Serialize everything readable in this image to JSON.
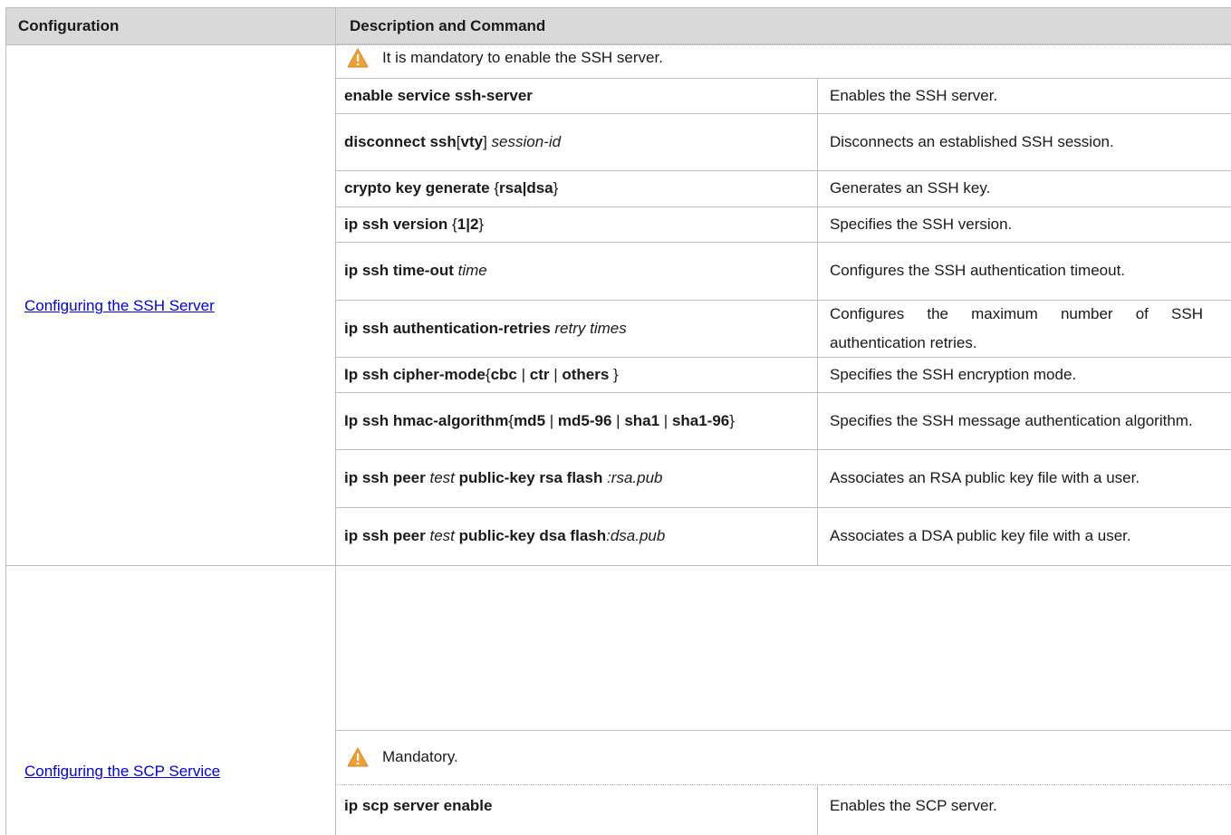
{
  "header": {
    "col1": "Configuration",
    "col2": "Description and Command"
  },
  "sections": [
    {
      "config_link": "Configuring the SSH Server",
      "note": "It is mandatory to enable the SSH server.",
      "note_icon": "warning-icon",
      "rows": [
        {
          "cmd_parts": [
            [
              "b",
              "enable service ssh-server"
            ]
          ],
          "desc": "Enables the SSH server."
        },
        {
          "cmd_parts": [
            [
              "b",
              "disconnect ssh"
            ],
            [
              "t",
              "["
            ],
            [
              "b",
              "vty"
            ],
            [
              "t",
              "] "
            ],
            [
              "i",
              "session-id"
            ]
          ],
          "desc": "Disconnects an established SSH session."
        },
        {
          "cmd_parts": [
            [
              "b",
              "crypto key generate "
            ],
            [
              "t",
              "{"
            ],
            [
              "b",
              "rsa|dsa"
            ],
            [
              "t",
              "}"
            ]
          ],
          "desc": "Generates an SSH key."
        },
        {
          "cmd_parts": [
            [
              "b",
              "ip ssh version "
            ],
            [
              "t",
              "{"
            ],
            [
              "b",
              "1|2"
            ],
            [
              "t",
              "}"
            ]
          ],
          "desc": "Specifies the SSH version."
        },
        {
          "cmd_parts": [
            [
              "b",
              "ip ssh time-out "
            ],
            [
              "i",
              "time"
            ]
          ],
          "desc": "Configures the SSH authentication timeout."
        },
        {
          "cmd_parts": [
            [
              "b",
              "ip ssh authentication-retries "
            ],
            [
              "i",
              "retry times"
            ]
          ],
          "desc": "Configures the maximum number of SSH authentication retries."
        },
        {
          "cmd_parts": [
            [
              "b",
              "Ip ssh cipher-mode"
            ],
            [
              "t",
              "{"
            ],
            [
              "b",
              "cbc"
            ],
            [
              "t",
              " | "
            ],
            [
              "b",
              "ctr"
            ],
            [
              "t",
              " | "
            ],
            [
              "b",
              "others"
            ],
            [
              "t",
              " }"
            ]
          ],
          "desc": "Specifies the SSH encryption mode."
        },
        {
          "cmd_parts": [
            [
              "b",
              "Ip ssh hmac-algorithm"
            ],
            [
              "t",
              "{"
            ],
            [
              "b",
              "md5"
            ],
            [
              "t",
              " | "
            ],
            [
              "b",
              "md5-96"
            ],
            [
              "t",
              " | "
            ],
            [
              "b",
              "sha1"
            ],
            [
              "t",
              " | "
            ],
            [
              "b",
              "sha1-96"
            ],
            [
              "t",
              "}"
            ]
          ],
          "desc": "Specifies the SSH message authentication algorithm."
        },
        {
          "cmd_parts": [
            [
              "b",
              "ip ssh peer "
            ],
            [
              "i",
              "test"
            ],
            [
              "b",
              " public-key rsa flash "
            ],
            [
              "i",
              ":rsa.pub"
            ]
          ],
          "desc": "Associates an RSA public key file with a user."
        },
        {
          "cmd_parts": [
            [
              "b",
              "ip ssh peer "
            ],
            [
              "i",
              "test"
            ],
            [
              "b",
              " public-key dsa flash"
            ],
            [
              "i",
              ":dsa.pub"
            ]
          ],
          "desc": "Associates a DSA public key file with a user."
        }
      ]
    },
    {
      "config_link": "Configuring the SCP Service",
      "note": "Mandatory.",
      "note_icon": "warning-icon",
      "rows": [
        {
          "cmd_parts": [
            [
              "b",
              "ip scp server enable"
            ]
          ],
          "desc": "Enables the SCP server."
        }
      ]
    }
  ],
  "colors": {
    "header_bg": "#d9d9d9",
    "link": "#0000ee",
    "warning": "#f0a030"
  }
}
